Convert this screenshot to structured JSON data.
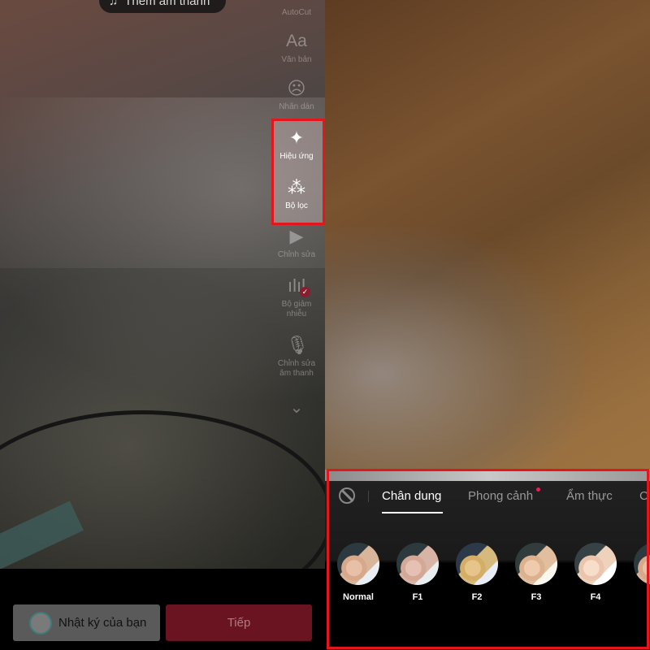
{
  "left": {
    "music_button": {
      "label": "Thêm âm thanh",
      "icon": "music-note-icon"
    },
    "sidebar": [
      {
        "label": "AutoCut",
        "icon": "autocut-icon"
      },
      {
        "label": "Văn bản",
        "icon": "text-icon",
        "glyph": "Aa"
      },
      {
        "label": "Nhãn dán",
        "icon": "sticker-icon"
      },
      {
        "label": "Hiệu ứng",
        "icon": "effects-icon",
        "highlighted": true
      },
      {
        "label": "Bộ lọc",
        "icon": "filters-icon",
        "highlighted": true
      },
      {
        "label": "Chỉnh sửa",
        "icon": "edit-clip-icon"
      },
      {
        "label": "Bộ giảm nhiễu",
        "icon": "noise-reducer-icon",
        "checked": true
      },
      {
        "label": "Chỉnh sửa âm thanh",
        "icon": "voice-edit-icon"
      }
    ],
    "more_icon": "chevron-down-icon",
    "diary_button": "Nhật ký của bạn",
    "next_button": "Tiếp"
  },
  "right": {
    "filter_panel": {
      "none_icon": "no-filter-icon",
      "tabs": [
        {
          "label": "Chân dung",
          "active": true
        },
        {
          "label": "Phong cảnh",
          "new_dot": true
        },
        {
          "label": "Ẩm thực"
        },
        {
          "label": "C"
        }
      ],
      "filters": [
        "Normal",
        "F1",
        "F2",
        "F3",
        "F4"
      ]
    }
  },
  "colors": {
    "highlight_border": "#e4161c",
    "next_button": "#6b1421",
    "new_dot": "#ee1d52"
  }
}
